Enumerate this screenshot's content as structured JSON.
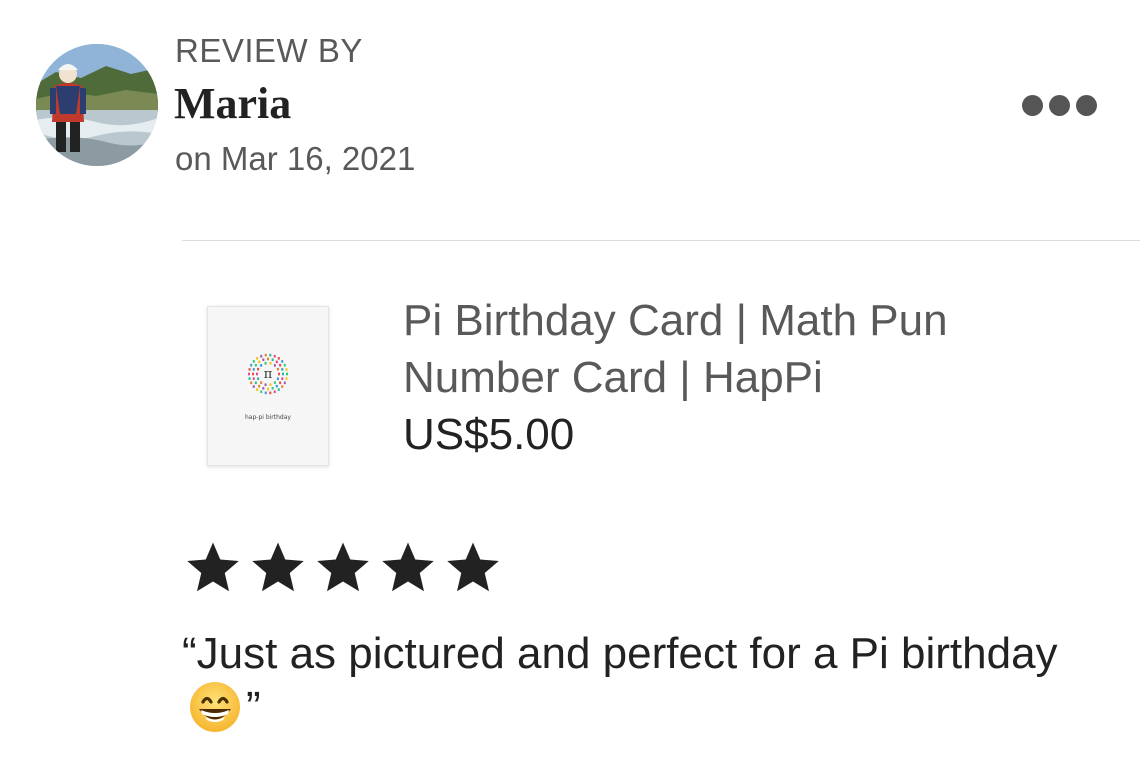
{
  "review": {
    "header_label": "REVIEW BY",
    "reviewer_name": "Maria",
    "date_text": "on Mar 16, 2021",
    "more_icon": "more-horizontal-icon",
    "avatar_icon": "reviewer-avatar-photo"
  },
  "listing": {
    "title_line_1": "Pi Birthday Card | Math Pun",
    "title_line_2": "Number Card | HapPi",
    "price": "US$5.00",
    "thumbnail_symbol": "π",
    "thumbnail_caption": "hap-pi birthday"
  },
  "rating": {
    "stars": 5,
    "max": 5,
    "star_color": "#222222"
  },
  "review_body": {
    "text_open": "“Just as pictured and perfect for a Pi birthday",
    "emoji": "grinning-face-emoji",
    "text_close": "”"
  },
  "colors": {
    "text_primary": "#222222",
    "text_secondary": "#595959",
    "divider": "#dddddd"
  }
}
